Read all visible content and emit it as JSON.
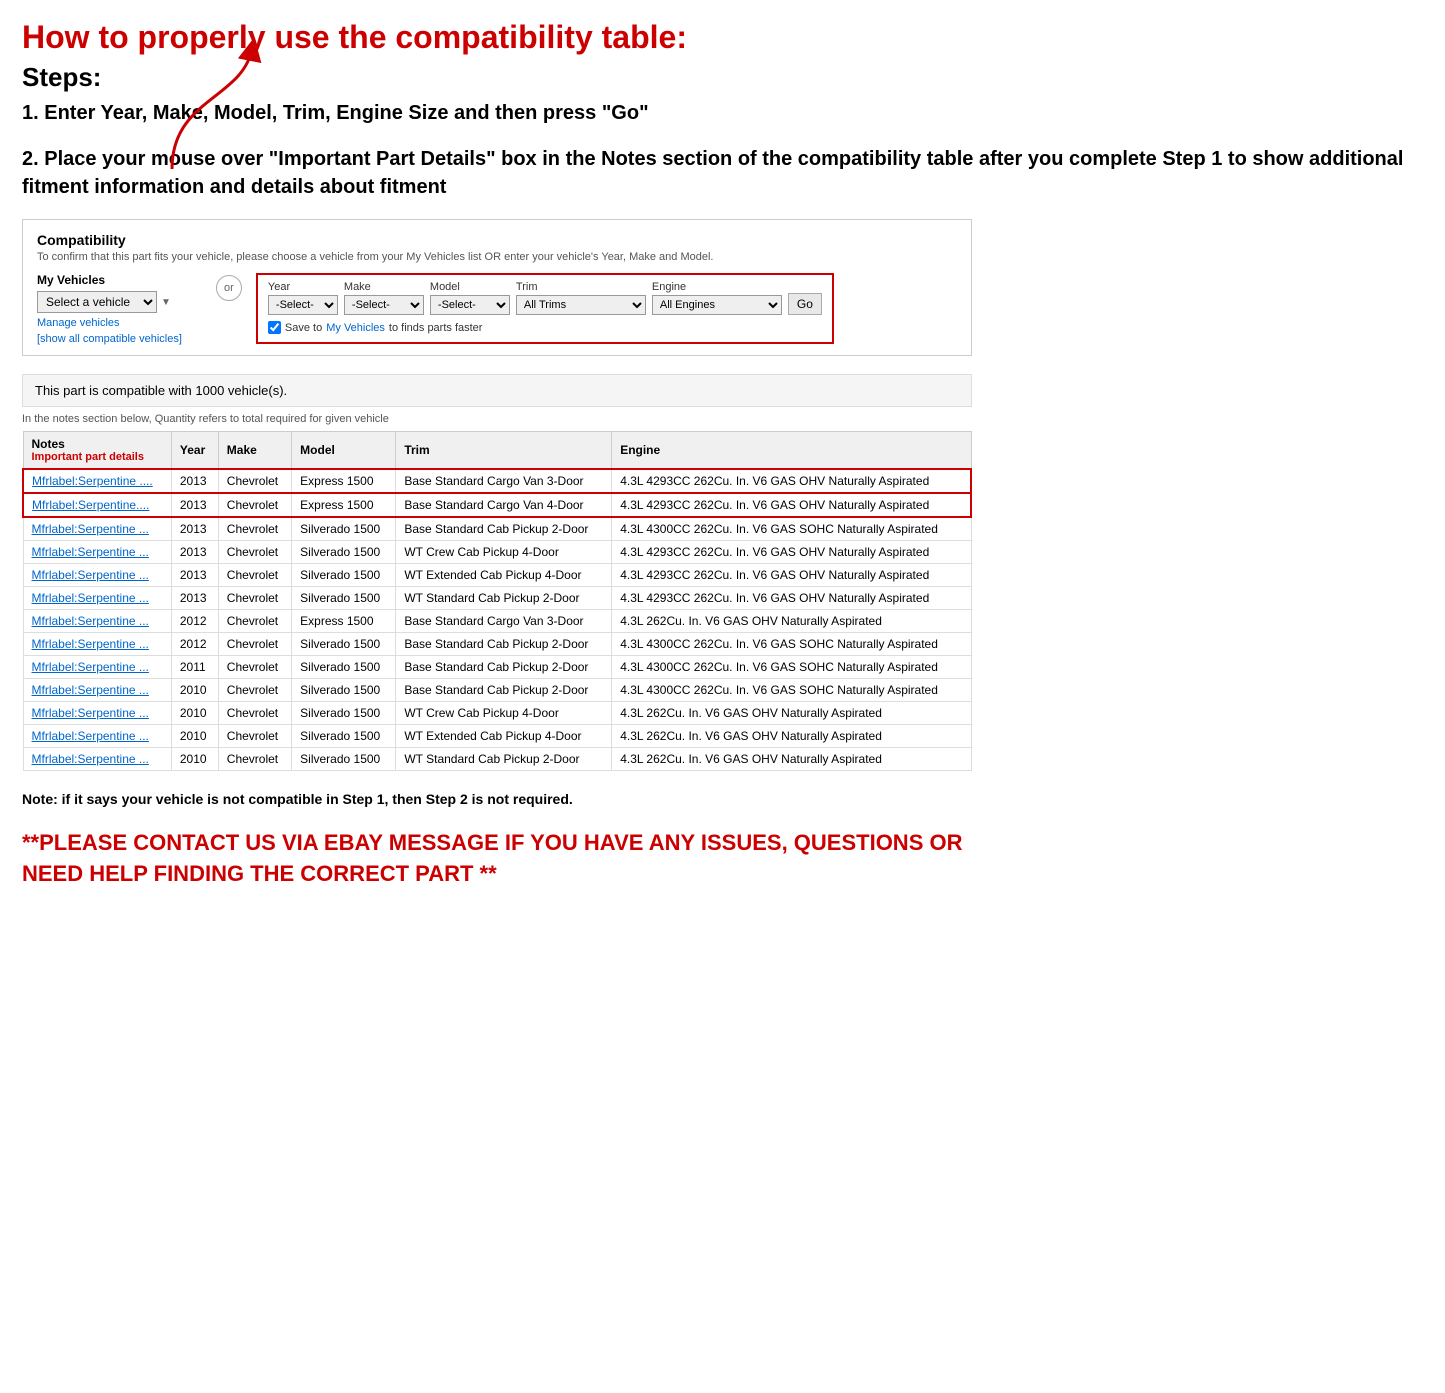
{
  "page": {
    "main_title": "How to properly use the compatibility table:",
    "steps_title": "Steps:",
    "step1": "1. Enter Year, Make, Model, Trim, Engine Size and then press \"Go\"",
    "step2": "2. Place your mouse over \"Important Part Details\" box in the Notes section of the compatibility table after you complete Step 1 to show additional fitment information and details about fitment",
    "note": "Note: if it says your vehicle is not compatible in Step 1, then Step 2 is not required.",
    "ebay_message": "**PLEASE CONTACT US VIA EBAY MESSAGE IF YOU HAVE ANY ISSUES, QUESTIONS OR NEED HELP FINDING THE CORRECT PART **"
  },
  "compatibility": {
    "header": "Compatibility",
    "subtext": "To confirm that this part fits your vehicle, please choose a vehicle from your My Vehicles list OR enter your vehicle's Year, Make and Model.",
    "my_vehicles_label": "My Vehicles",
    "select_vehicle_placeholder": "Select a vehicle",
    "manage_vehicles": "Manage vehicles",
    "show_compatible": "[show all compatible vehicles]",
    "or_label": "or",
    "year_label": "Year",
    "make_label": "Make",
    "model_label": "Model",
    "trim_label": "Trim",
    "engine_label": "Engine",
    "year_default": "-Select-",
    "make_default": "-Select-",
    "model_default": "-Select-",
    "trim_default": "All Trims",
    "engine_default": "All Engines",
    "go_label": "Go",
    "save_text": "Save to ",
    "save_link": "My Vehicles",
    "save_suffix": " to finds parts faster",
    "compatible_count": "This part is compatible with 1000 vehicle(s).",
    "quantity_note": "In the notes section below, Quantity refers to total required for given vehicle",
    "table": {
      "columns": [
        "Notes",
        "Year",
        "Make",
        "Model",
        "Trim",
        "Engine"
      ],
      "notes_sublabel": "Important part details",
      "rows": [
        {
          "notes": "Mfrlabel:Serpentine ....",
          "year": "2013",
          "make": "Chevrolet",
          "model": "Express 1500",
          "trim": "Base Standard Cargo Van 3-Door",
          "engine": "4.3L 4293CC 262Cu. In. V6 GAS OHV Naturally Aspirated",
          "highlight": true
        },
        {
          "notes": "Mfrlabel:Serpentine....",
          "year": "2013",
          "make": "Chevrolet",
          "model": "Express 1500",
          "trim": "Base Standard Cargo Van 4-Door",
          "engine": "4.3L 4293CC 262Cu. In. V6 GAS OHV Naturally Aspirated",
          "highlight": true
        },
        {
          "notes": "Mfrlabel:Serpentine ...",
          "year": "2013",
          "make": "Chevrolet",
          "model": "Silverado 1500",
          "trim": "Base Standard Cab Pickup 2-Door",
          "engine": "4.3L 4300CC 262Cu. In. V6 GAS SOHC Naturally Aspirated",
          "highlight": false
        },
        {
          "notes": "Mfrlabel:Serpentine ...",
          "year": "2013",
          "make": "Chevrolet",
          "model": "Silverado 1500",
          "trim": "WT Crew Cab Pickup 4-Door",
          "engine": "4.3L 4293CC 262Cu. In. V6 GAS OHV Naturally Aspirated",
          "highlight": false
        },
        {
          "notes": "Mfrlabel:Serpentine ...",
          "year": "2013",
          "make": "Chevrolet",
          "model": "Silverado 1500",
          "trim": "WT Extended Cab Pickup 4-Door",
          "engine": "4.3L 4293CC 262Cu. In. V6 GAS OHV Naturally Aspirated",
          "highlight": false
        },
        {
          "notes": "Mfrlabel:Serpentine ...",
          "year": "2013",
          "make": "Chevrolet",
          "model": "Silverado 1500",
          "trim": "WT Standard Cab Pickup 2-Door",
          "engine": "4.3L 4293CC 262Cu. In. V6 GAS OHV Naturally Aspirated",
          "highlight": false
        },
        {
          "notes": "Mfrlabel:Serpentine ...",
          "year": "2012",
          "make": "Chevrolet",
          "model": "Express 1500",
          "trim": "Base Standard Cargo Van 3-Door",
          "engine": "4.3L 262Cu. In. V6 GAS OHV Naturally Aspirated",
          "highlight": false
        },
        {
          "notes": "Mfrlabel:Serpentine ...",
          "year": "2012",
          "make": "Chevrolet",
          "model": "Silverado 1500",
          "trim": "Base Standard Cab Pickup 2-Door",
          "engine": "4.3L 4300CC 262Cu. In. V6 GAS SOHC Naturally Aspirated",
          "highlight": false
        },
        {
          "notes": "Mfrlabel:Serpentine ...",
          "year": "2011",
          "make": "Chevrolet",
          "model": "Silverado 1500",
          "trim": "Base Standard Cab Pickup 2-Door",
          "engine": "4.3L 4300CC 262Cu. In. V6 GAS SOHC Naturally Aspirated",
          "highlight": false
        },
        {
          "notes": "Mfrlabel:Serpentine ...",
          "year": "2010",
          "make": "Chevrolet",
          "model": "Silverado 1500",
          "trim": "Base Standard Cab Pickup 2-Door",
          "engine": "4.3L 4300CC 262Cu. In. V6 GAS SOHC Naturally Aspirated",
          "highlight": false
        },
        {
          "notes": "Mfrlabel:Serpentine ...",
          "year": "2010",
          "make": "Chevrolet",
          "model": "Silverado 1500",
          "trim": "WT Crew Cab Pickup 4-Door",
          "engine": "4.3L 262Cu. In. V6 GAS OHV Naturally Aspirated",
          "highlight": false
        },
        {
          "notes": "Mfrlabel:Serpentine ...",
          "year": "2010",
          "make": "Chevrolet",
          "model": "Silverado 1500",
          "trim": "WT Extended Cab Pickup 4-Door",
          "engine": "4.3L 262Cu. In. V6 GAS OHV Naturally Aspirated",
          "highlight": false
        },
        {
          "notes": "Mfrlabel:Serpentine ...",
          "year": "2010",
          "make": "Chevrolet",
          "model": "Silverado 1500",
          "trim": "WT Standard Cab Pickup 2-Door",
          "engine": "4.3L 262Cu. In. V6 GAS OHV Naturally Aspirated",
          "highlight": false
        }
      ]
    }
  }
}
